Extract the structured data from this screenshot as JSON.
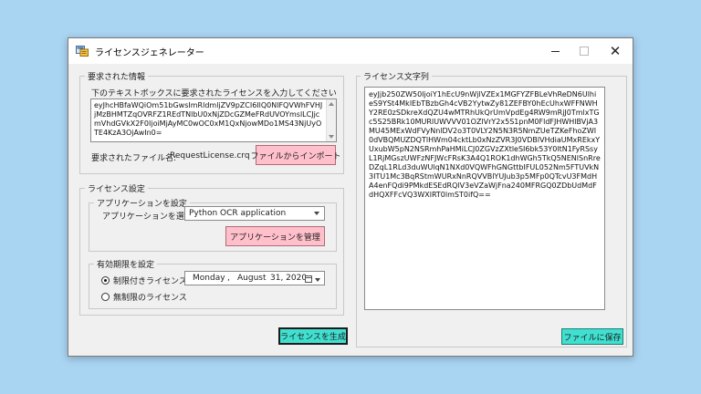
{
  "window": {
    "title": "ライセンスジェネレーター"
  },
  "request_group": {
    "label": "要求された情報",
    "instruction": "下のテキストボックスに要求されたライセンスを入力してください",
    "request_text": "eyJhcHBfaWQiOm51bGwsImRldmljZV9pZCI6IlQ0NlFQVWhFVHJjMzBHMTZqOVRFZ1REdTNlbU0xNjZDcGZMeFRdUVOYmslLCJjcmVhdGVkX2F0IjoiMjAyMC0wOC0xM1QxNjowMDo1MS43NjUyOTE4KzA3OjAwIn0=",
    "file_label": "要求されたファイル名:",
    "file_name": "RequestLicense.crq",
    "import_button": "ファイルからインポート"
  },
  "license_settings": {
    "label": "ライセンス設定",
    "app_group_label": "アプリケーションを設定",
    "app_select_label": "アプリケーションを選択",
    "app_selected": "Python OCR application",
    "manage_button": "アプリケーションを管理",
    "expiry_group_label": "有効期限を設定",
    "radio_limited": "制限付きライセンス",
    "radio_unlimited": "無制限のライセンス",
    "limited_checked": true,
    "date_weekday": "Monday",
    "date_sep": ",",
    "date_month": "August",
    "date_day_year": "31, 2020"
  },
  "generate_button": "ライセンスを生成",
  "license_output": {
    "label": "ライセンス文字列",
    "text": "eyJjb250ZW50IjoiY1hEcU9nWjlVZEx1MGFYZFBLeVhReDN6UlhieS9YSt4MklEbTBzbGh4cVB2YytwZy81ZEFBY0hEcUhxWFFNWHY2RE0zSDkreXdQZU4wMTRhUkQrUmVpdEg4RW9mRjJ0TmlxTGc5S25BRk10MURIUWVVV01OZlVrY2x5S1pnM0FldFJHWHlBVjA3MU45MExWdFVyNnlDV2o3T0VLY2N5N3R5NmZUeTZKeFhoZWI0dVBQMUZDQTlHWm04cktLb0xNzZVR3J0VDBlVHdiaUMxREkxYUxubW5pN2NSRmhPaHMiLCJ0ZGVzZXtleSI6bk53Y0ltN1FyRSsyL1RjMGszUWFzNFJWcFRsK3A4Q1ROK1dhWGh5TkQ5NENlSnRreDZqL1RLd3duWUlqN1NXd0VQWFhGNGttbIFUL052Nm5FTUVkN3ITU1Mc3BqRStmWURxNnRQVVBlYUJub3p5MFp0QTcvU3FMdHA4enFQdi9PMkdESEdRQlV3eVZaWjFna240MFRGQ0ZDbUdMdFdHQXFFcVQ3WXlRT0lmST0ifQ==",
    "save_button": "ファイルに保存"
  }
}
